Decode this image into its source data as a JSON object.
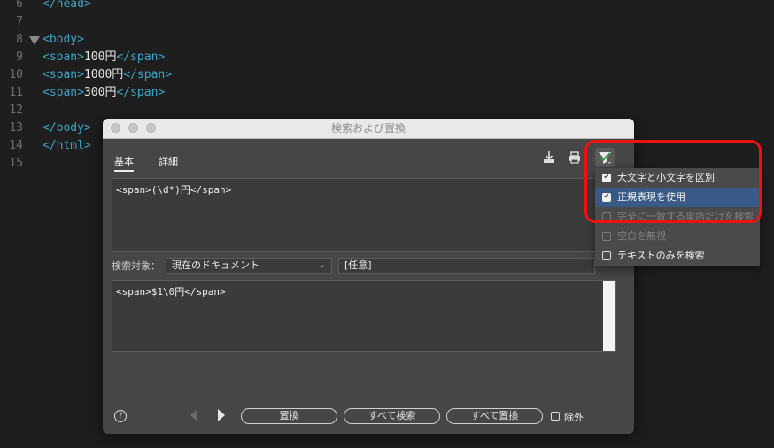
{
  "editor": {
    "lines": [
      {
        "num": "6",
        "code": "</head>",
        "kind": "tag"
      },
      {
        "num": "7",
        "code": "",
        "kind": "txt"
      },
      {
        "num": "8",
        "code": "<body>",
        "kind": "tag"
      },
      {
        "num": "9",
        "open": "<span>",
        "text": "100円",
        "close": "</span>"
      },
      {
        "num": "10",
        "open": "<span>",
        "text": "1000円",
        "close": "</span>"
      },
      {
        "num": "11",
        "open": "<span>",
        "text": "300円",
        "close": "</span>"
      },
      {
        "num": "12",
        "code": "",
        "kind": "txt"
      },
      {
        "num": "13",
        "code": "</body>",
        "kind": "tag"
      },
      {
        "num": "14",
        "code": "</html>",
        "kind": "tag"
      },
      {
        "num": "15",
        "code": "",
        "kind": "txt"
      }
    ]
  },
  "dialog": {
    "title": "検索および置換",
    "tabs": {
      "basic": "基本",
      "detail": "詳細"
    },
    "find_text": "<span>(\\d*)円</span>",
    "replace_text": "<span>$1\\0円</span>",
    "search_target_label": "検索対象：",
    "search_target_value": "現在のドキュメント",
    "search_option_value": "[任意]",
    "buttons": {
      "replace": "置換",
      "find_all": "すべて検索",
      "replace_all": "すべて置換",
      "exclude": "除外"
    },
    "help": "?"
  },
  "menu": {
    "items": [
      {
        "label": "大文字と小文字を区別",
        "checked": true,
        "disabled": false
      },
      {
        "label": "正規表現を使用",
        "checked": true,
        "disabled": false
      },
      {
        "label": "完全に一致する単語だけを検索",
        "checked": false,
        "disabled": true
      },
      {
        "label": "空白を無視",
        "checked": false,
        "disabled": true
      },
      {
        "label": "テキストのみを検索",
        "checked": false,
        "disabled": false
      }
    ]
  },
  "colors": {
    "tag": "#3aa6c9",
    "highlight": "#e11111",
    "selected": "#395a86"
  }
}
